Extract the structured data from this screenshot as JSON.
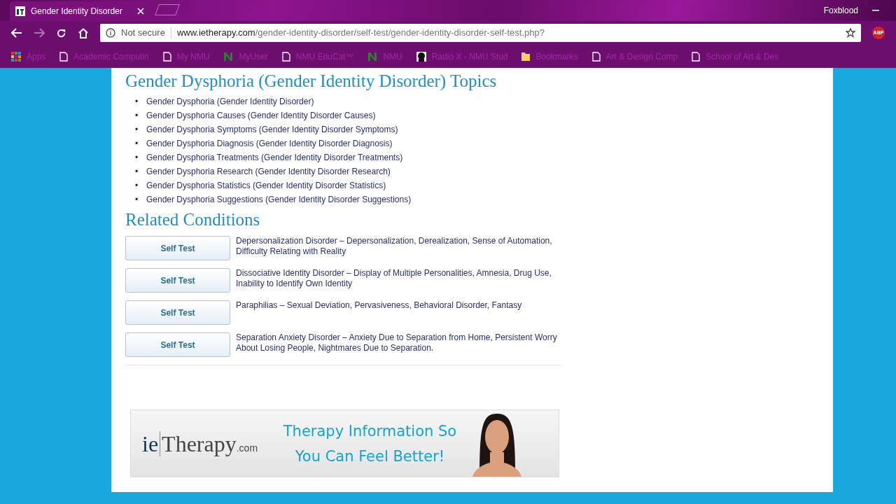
{
  "browser": {
    "tab_title": "Gender Identity Disorder",
    "profile": "Foxblood",
    "security": "Not secure",
    "url_host": "www.ietherapy.com",
    "url_path": "/gender-identity-disorder/self-test/gender-identity-disorder-self-test.php?",
    "extension": "ABP",
    "bookmarks": [
      {
        "kind": "apps",
        "label": "Apps"
      },
      {
        "kind": "page",
        "label": "Academic Computin"
      },
      {
        "kind": "page",
        "label": "My NMU"
      },
      {
        "kind": "nmu",
        "label": "MyUser"
      },
      {
        "kind": "page",
        "label": "NMU EduCat™"
      },
      {
        "kind": "nmu",
        "label": "NMU"
      },
      {
        "kind": "radio",
        "label": "Radio X - NMU Stud"
      },
      {
        "kind": "folder",
        "label": "Bookmarks"
      },
      {
        "kind": "page",
        "label": "Art & Design Comp"
      },
      {
        "kind": "page",
        "label": "School of Art & Des"
      }
    ]
  },
  "page": {
    "topics_heading": "Gender Dysphoria (Gender Identity Disorder) Topics",
    "topics": [
      {
        "bullet": "•",
        "label": "Gender Dysphoria (Gender Identity Disorder)"
      },
      {
        "bullet": "•",
        "label": "Gender Dysphoria Causes (Gender Identity Disorder Causes)"
      },
      {
        "bullet": "•",
        "label": "Gender Dysphoria Symptoms (Gender Identity Disorder Symptoms)"
      },
      {
        "bullet": "•",
        "label": "Gender Dysphoria Diagnosis (Gender Identity Disorder Diagnosis)"
      },
      {
        "bullet": "•",
        "label": "Gender Dysphoria Treatments (Gender Identity Disorder Treatments)"
      },
      {
        "bullet": "•",
        "label": "Gender Dysphoria Research (Gender Identity Disorder Research)"
      },
      {
        "bullet": "•",
        "label": "Gender Dysphoria Statistics (Gender Identity Disorder Statistics)"
      },
      {
        "bullet": "•",
        "label": "Gender Dysphoria Suggestions (Gender Identity Disorder Suggestions)"
      }
    ],
    "related_heading": "Related Conditions",
    "conditions": [
      {
        "button": "Self Test",
        "description": "Depersonalization Disorder – Depersonalization, Derealization, Sense of Automation, Difficulty Relating with Reality"
      },
      {
        "button": "Self Test",
        "description": "Dissociative Identity Disorder – Display of Multiple Personalities, Amnesia, Drug Use, Inability to Identify Own Identity"
      },
      {
        "button": "Self Test",
        "description": "Paraphilias – Sexual Deviation, Pervasiveness, Behavioral Disorder, Fantasy"
      },
      {
        "button": "Self Test",
        "description": "Separation Anxiety Disorder – Anxiety Due to Separation from Home, Persistent Worry About Losing People, Nightmares Due to Separation."
      }
    ],
    "banner": {
      "logo_prefix": "ie",
      "logo_main": "Therapy",
      "logo_suffix": ".com",
      "headline": [
        "Therapy Information So",
        "You Can Feel Better!"
      ]
    }
  }
}
